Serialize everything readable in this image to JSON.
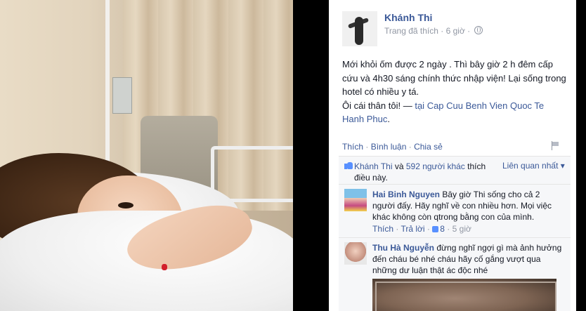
{
  "post": {
    "author": "Khánh Thi",
    "meta": "Trang đã thích · 6 giờ ·",
    "text_line1": "Mới khỏi ốm được 2 ngày . Thì bây giờ 2 h đêm cấp cứu và 4h30 sáng chính thức nhập viện! Lại sống trong hotel có nhiều y tá.",
    "text_line2_prefix": "Ôi cái thân tôi! — ",
    "text_tai": "tại",
    "location": "Cap Cuu Benh Vien Quoc Te Hanh Phuc",
    "text_end": "."
  },
  "actions": {
    "like": "Thích",
    "comment": "Bình luận",
    "share": "Chia sẻ",
    "sep": " · "
  },
  "likes": {
    "name": "Khánh Thi",
    "and": " và ",
    "others": "592 người khác",
    "suffix": " thích điều này.",
    "relevant": "Liên quan nhất ▾"
  },
  "comments": [
    {
      "name": "Hai Binh Nguyen",
      "text": " Bây giờ Thi sống cho cả 2 người đấy. Hãy nghĩ về con nhiều hơn. Mọi việc khác không còn qtrong bằng con của mình.",
      "like": "Thích",
      "reply": "Trả lời",
      "like_count": "8",
      "time": "5 giờ"
    },
    {
      "name": "Thu Hà Nguyễn",
      "text": " đừng nghĩ ngợi gì mà ảnh hưởng đến cháu bé nhé cháu hãy cố gắng vượt qua những dư luận thật ác độc nhé"
    }
  ],
  "close_glyph": "×",
  "colors": {
    "link": "#3b5998",
    "muted": "#9197a3",
    "like_blue": "#5890ff"
  }
}
